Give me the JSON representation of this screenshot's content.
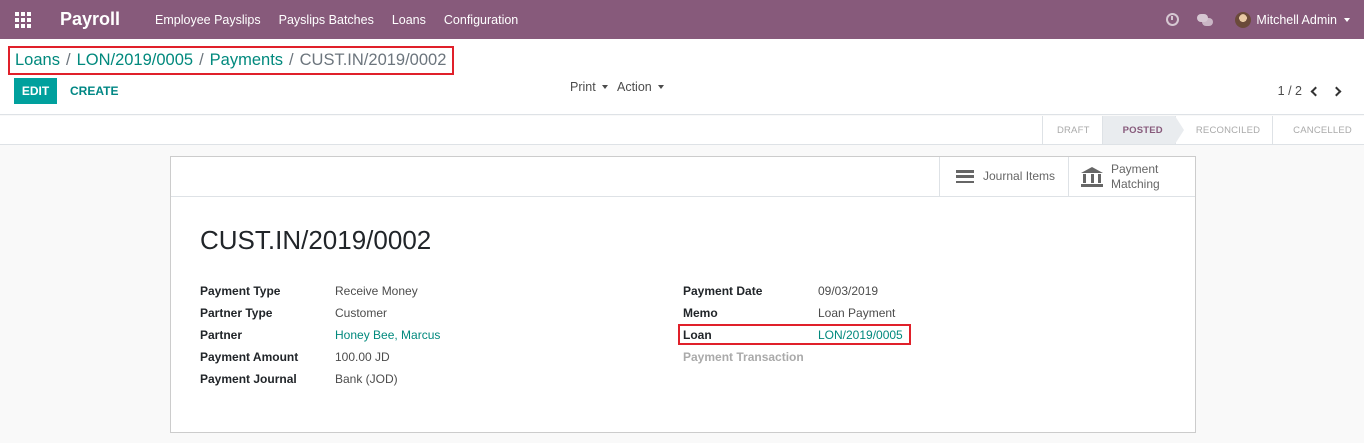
{
  "navbar": {
    "app_title": "Payroll",
    "menu": [
      "Employee Payslips",
      "Payslips Batches",
      "Loans",
      "Configuration"
    ],
    "user_name": "Mitchell Admin",
    "icons": [
      "apps-icon",
      "clock-icon",
      "chat-icon",
      "avatar"
    ]
  },
  "breadcrumb": {
    "items": [
      "Loans",
      "LON/2019/0005",
      "Payments"
    ],
    "current": "CUST.IN/2019/0002",
    "separator": "/"
  },
  "toolbar": {
    "edit_label": "EDIT",
    "create_label": "CREATE",
    "print_label": "Print",
    "action_label": "Action"
  },
  "pager": {
    "value": "1 / 2"
  },
  "statusbar": {
    "steps": [
      "DRAFT",
      "POSTED",
      "RECONCILED",
      "CANCELLED"
    ],
    "active": "POSTED"
  },
  "smart_buttons": {
    "journal_items": "Journal Items",
    "payment_matching_line1": "Payment",
    "payment_matching_line2": "Matching"
  },
  "record": {
    "title": "CUST.IN/2019/0002",
    "left_fields": [
      {
        "label": "Payment Type",
        "value": "Receive Money"
      },
      {
        "label": "Partner Type",
        "value": "Customer"
      },
      {
        "label": "Partner",
        "value": "Honey Bee, Marcus"
      },
      {
        "label": "Payment Amount",
        "value": "100.00 JD"
      },
      {
        "label": "Payment Journal",
        "value": "Bank (JOD)"
      }
    ],
    "right_fields": [
      {
        "label": "Payment Date",
        "value": "09/03/2019"
      },
      {
        "label": "Memo",
        "value": "Loan Payment"
      },
      {
        "label": "Loan",
        "value": "LON/2019/0005"
      },
      {
        "label": "Payment Transaction",
        "value": ""
      }
    ]
  },
  "colors": {
    "navbar": "#875a7b",
    "primary_button": "#00a09d",
    "link": "#01897d",
    "highlight_box": "#e0202a"
  }
}
